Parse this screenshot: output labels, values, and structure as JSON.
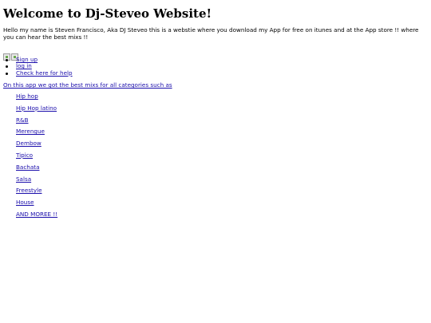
{
  "header": {
    "title": "Welcome to Dj-Steveo Website!"
  },
  "intro": {
    "text": "Hello my name is Steven Francisco, Aka DJ Steveo this is a webstie where you download my App for free on itunes and at the App store !! where you can hear the best mixs !!"
  },
  "images": [
    "broken-image-icon",
    "broken-image-icon"
  ],
  "auth_links": {
    "sign_up": "Sign up",
    "log_in": "log in",
    "help": "Check here for help"
  },
  "categories_intro": "On this app we got the best mixs for all categories such as",
  "categories": [
    "Hip hop",
    "Hip Hop latino",
    "R&B",
    "Merengue",
    "Dembow",
    "Tipico",
    "Bachata",
    "Salsa",
    "Freestyle",
    "House",
    "AND MOREE !!"
  ],
  "colors": {
    "link": "#1a0dab",
    "text": "#000000",
    "background": "#ffffff"
  }
}
